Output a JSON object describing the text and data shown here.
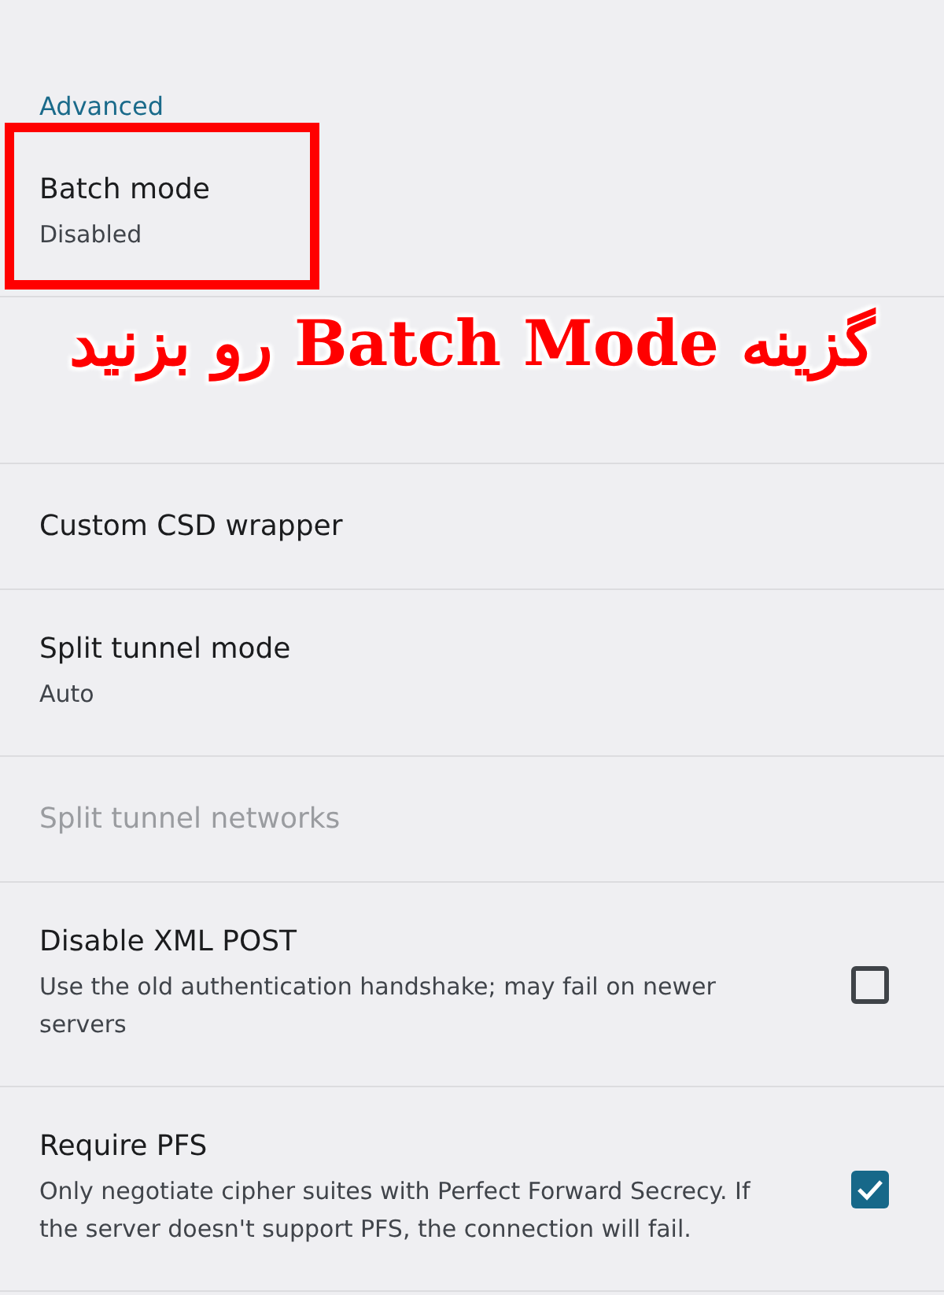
{
  "items": [
    {
      "kind": "category",
      "title": "Advanced"
    },
    {
      "kind": "preference",
      "title": "Batch mode",
      "summary": "Disabled",
      "disabled": false,
      "highlighted": true
    },
    {
      "kind": "covered"
    },
    {
      "kind": "preference",
      "title": "Custom CSD wrapper",
      "disabled": false,
      "highlighted": false
    },
    {
      "kind": "preference",
      "title": "Split tunnel mode",
      "summary": "Auto",
      "disabled": false,
      "highlighted": false
    },
    {
      "kind": "preference",
      "title": "Split tunnel networks",
      "disabled": true,
      "highlighted": false
    },
    {
      "kind": "checkbox",
      "title": "Disable XML POST",
      "summary": "Use the old authentication handshake; may fail on newer servers",
      "checked": false
    },
    {
      "kind": "checkbox",
      "title": "Require PFS",
      "summary": "Only negotiate cipher suites with Perfect Forward Secrecy. If the server doesn't support PFS, the connection will fail.",
      "checked": true
    }
  ],
  "annotation": {
    "text": "گزینه Batch Mode رو بزنید"
  }
}
